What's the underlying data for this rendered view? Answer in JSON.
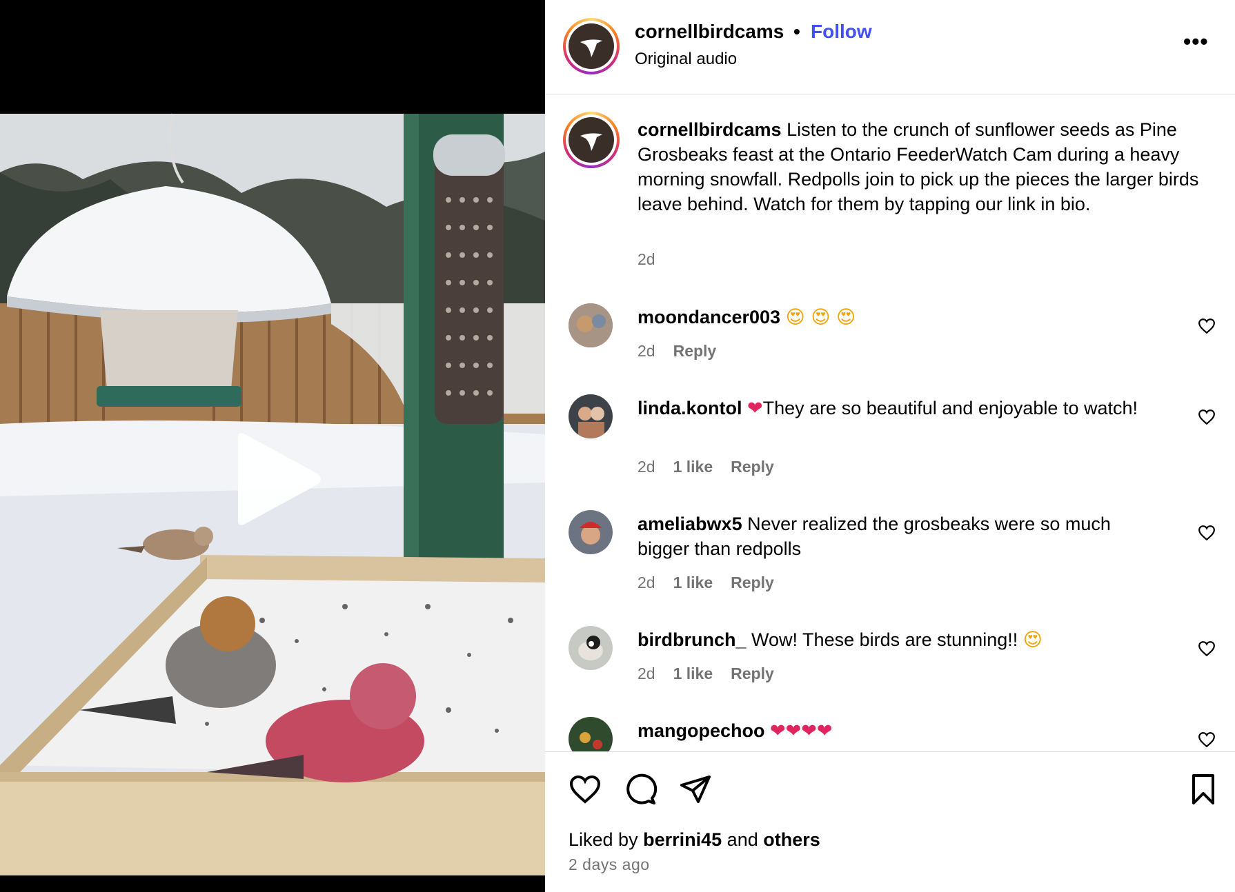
{
  "post": {
    "username": "cornellbirdcams",
    "follow_label": "Follow",
    "separator": "•",
    "audio": "Original audio",
    "more_label": "•••"
  },
  "caption": {
    "username": "cornellbirdcams",
    "text": "Listen to the crunch of sunflower seeds as Pine Grosbeaks feast at the Ontario FeederWatch Cam during a heavy morning snowfall. Redpolls join to pick up the pieces the larger birds leave behind. Watch for them by tapping our link in bio.",
    "time": "2d"
  },
  "comments": [
    {
      "username": "moondancer003",
      "text": "",
      "emoji": "😍 😍 😍",
      "time": "2d",
      "likes": "",
      "reply": "Reply"
    },
    {
      "username": "linda.kontol",
      "emoji": "❤",
      "text": "They are so beautiful and enjoyable to watch!",
      "time": "2d",
      "likes": "1 like",
      "reply": "Reply"
    },
    {
      "username": "ameliabwx5",
      "text": "Never realized the grosbeaks were so much bigger than redpolls",
      "emoji": "",
      "time": "2d",
      "likes": "1 like",
      "reply": "Reply"
    },
    {
      "username": "birdbrunch_",
      "text": "Wow! These birds are stunning!!",
      "emoji": "😍",
      "time": "2d",
      "likes": "1 like",
      "reply": "Reply"
    },
    {
      "username": "mangopechoo",
      "text": "",
      "emoji": "❤❤❤❤",
      "time": "",
      "likes": "",
      "reply": ""
    }
  ],
  "footer": {
    "liked_prefix": "Liked by",
    "liked_user": "berrini45",
    "liked_and": "and",
    "liked_others": "others",
    "time_ago": "2 days ago"
  },
  "icons": {
    "like": "heart-icon",
    "comment": "comment-bubble-icon",
    "share": "paper-plane-icon",
    "save": "bookmark-icon",
    "play": "play-icon"
  },
  "colors": {
    "follow": "#4150f7",
    "muted": "#737373",
    "divider": "#dbdbdb"
  }
}
